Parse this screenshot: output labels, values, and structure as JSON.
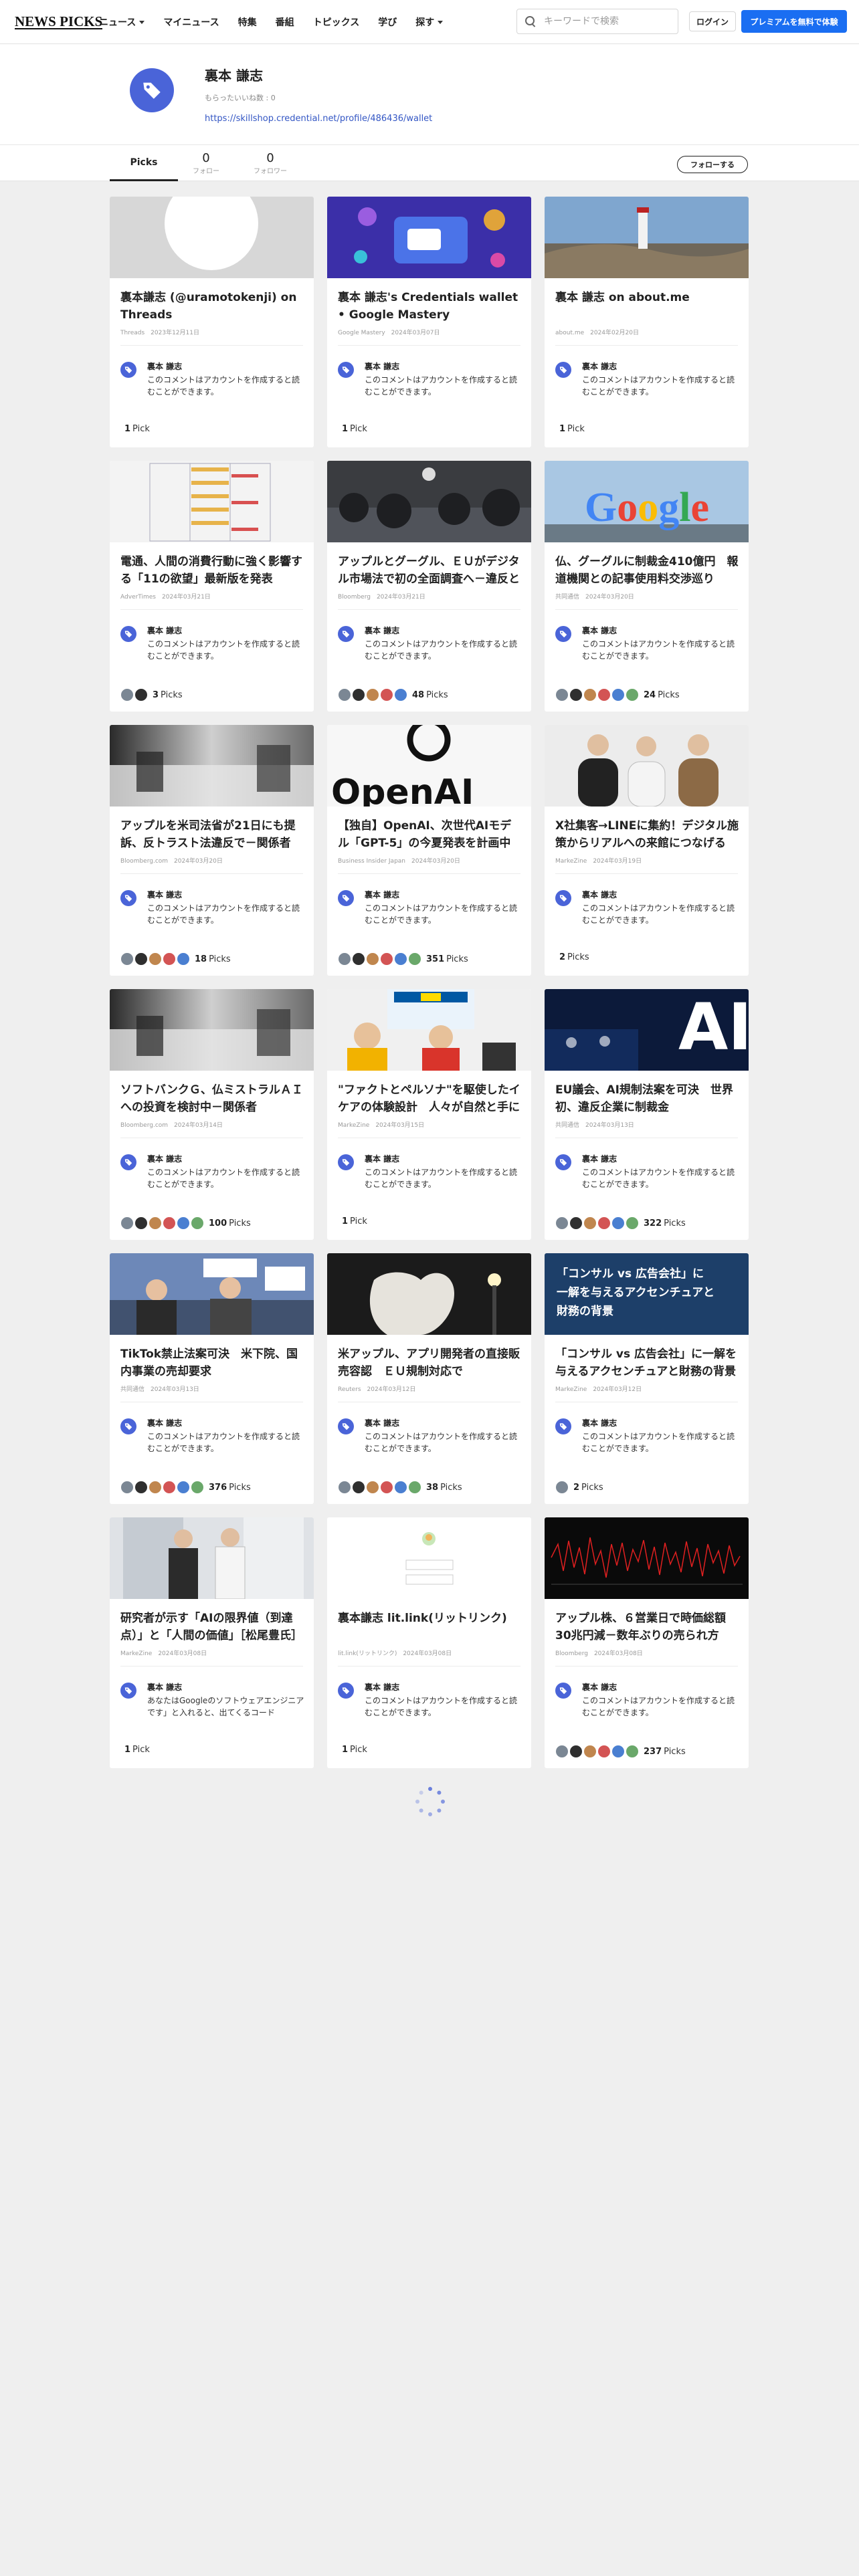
{
  "header": {
    "logo": "NEWS PICKS",
    "nav": [
      {
        "label": "ニュース",
        "dropdown": true
      },
      {
        "label": "マイニュース",
        "dropdown": false
      },
      {
        "label": "特集",
        "dropdown": false
      },
      {
        "label": "番組",
        "dropdown": false
      },
      {
        "label": "トピックス",
        "dropdown": false
      },
      {
        "label": "学び",
        "dropdown": false
      },
      {
        "label": "探す",
        "dropdown": true
      }
    ],
    "search_placeholder": "キーワードで検索",
    "login_label": "ログイン",
    "premium_label": "プレミアムを無料で体験"
  },
  "profile": {
    "name": "裏本 謙志",
    "liked": "もらったいいね数 : 0",
    "link": "https://skillshop.credential.net/profile/486436/wallet"
  },
  "tabs": {
    "picks_label": "Picks",
    "following_count": "0",
    "following_label": "フォロー",
    "followers_count": "0",
    "followers_label": "フォロワー",
    "follow_button": "フォローする"
  },
  "colors": {
    "accent": "#1a6ef2",
    "icon_blue": "#4a64d8",
    "link": "#3356c4"
  },
  "comment": {
    "author": "裏本 謙志",
    "text": "このコメントはアカウントを作成すると読むことができます。"
  },
  "cards": [
    {
      "title": "裏本謙志 (@uramotokenji) on Threads",
      "meta": "Threads　2023年12月11日",
      "picks": "1",
      "pick_label": "Pick",
      "avatars": 0,
      "thumb": "threads"
    },
    {
      "title": "裏本 謙志's Credentials wallet • Google Mastery",
      "meta": "Google Mastery　2024年03月07日",
      "picks": "1",
      "pick_label": "Pick",
      "avatars": 0,
      "thumb": "credentials"
    },
    {
      "title": "裏本 謙志 on about.me",
      "meta": "about.me　2024年02月20日",
      "picks": "1",
      "pick_label": "Pick",
      "avatars": 0,
      "thumb": "lighthouse"
    },
    {
      "title": "電通、人間の消費行動に強く影響する「11の欲望」最新版を発表",
      "meta": "AdverTimes　2024年03月21日",
      "picks": "3",
      "pick_label": "Picks",
      "avatars": 2,
      "thumb": "table"
    },
    {
      "title": "アップルとグーグル、ＥＵがデジタル市場法で初の全面調査へ－違反と判断なら制裁金も",
      "meta": "Bloomberg　2024年03月21日",
      "picks": "48",
      "pick_label": "Picks",
      "avatars": 5,
      "thumb": "applestore"
    },
    {
      "title": "仏、グーグルに制裁金410億円　報道機関との記事使用料交渉巡り",
      "meta": "共同通信　2024年03月20日",
      "picks": "24",
      "pick_label": "Picks",
      "avatars": 6,
      "thumb": "google"
    },
    {
      "title": "アップルを米司法省が21日にも提訴、反トラスト法違反で－関係者",
      "meta": "Bloomberg.com　2024年03月20日",
      "picks": "18",
      "pick_label": "Picks",
      "avatars": 5,
      "thumb": "chairs"
    },
    {
      "title": "【独自】OpenAI、次世代AIモデル「GPT-5」の今夏発表を計画中",
      "meta": "Business Insider Japan　2024年03月20日",
      "picks": "351",
      "pick_label": "Picks",
      "avatars": 6,
      "thumb": "openai"
    },
    {
      "title": "X社集客→LINEに集約！デジタル施策からリアルへの来館につなげる",
      "meta": "MarkeZine　2024年03月19日",
      "picks": "2",
      "pick_label": "Picks",
      "avatars": 0,
      "thumb": "people3"
    },
    {
      "title": "ソフトバンクＧ、仏ミストラルＡＩへの投資を検討中－関係者",
      "meta": "Bloomberg.com　2024年03月14日",
      "picks": "100",
      "pick_label": "Picks",
      "avatars": 6,
      "thumb": "chairs"
    },
    {
      "title": "\"ファクトとペルソナ\"を駆使したイケアの体験設計　人々が自然と手に取る仕組み",
      "meta": "MarkeZine　2024年03月15日",
      "picks": "1",
      "pick_label": "Pick",
      "avatars": 0,
      "thumb": "ikea"
    },
    {
      "title": "EU議会、AI規制法案を可決　世界初、違反企業に制裁金",
      "meta": "共同通信　2024年03月13日",
      "picks": "322",
      "pick_label": "Picks",
      "avatars": 6,
      "thumb": "ai"
    },
    {
      "title": "TikTok禁止法案可決　米下院、国内事業の売却要求",
      "meta": "共同通信　2024年03月13日",
      "picks": "376",
      "pick_label": "Picks",
      "avatars": 6,
      "thumb": "tiktok"
    },
    {
      "title": "米アップル、アプリ開発者の直接販売容認　ＥＵ規制対応で",
      "meta": "Reuters　2024年03月12日",
      "picks": "38",
      "pick_label": "Picks",
      "avatars": 6,
      "thumb": "applelogo"
    },
    {
      "title": "「コンサル vs 広告会社」に一解を与えるアクセンチュアと財務の背景",
      "meta": "MarkeZine　2024年03月12日",
      "picks": "2",
      "pick_label": "Picks",
      "avatars": 1,
      "thumb": "consul"
    },
    {
      "title": "研究者が示す「AIの限界値（到達点）」と「人間の価値」［松尾豊氏］",
      "meta": "MarkeZine　2024年03月08日",
      "picks": "1",
      "pick_label": "Pick",
      "avatars": 0,
      "thumb": "twomen",
      "comment_text": "あなたはGoogleのソフトウェアエンジニアです」と入れると、出てくるコード"
    },
    {
      "title": "裏本謙志 lit.link(リットリンク)",
      "meta": "lit.link(リットリンク)　2024年03月08日",
      "picks": "1",
      "pick_label": "Pick",
      "avatars": 0,
      "thumb": "litlink"
    },
    {
      "title": "アップル株、６営業日で時価総額30兆円減－数年ぶりの売られ方",
      "meta": "Bloomberg　2024年03月08日",
      "picks": "237",
      "pick_label": "Picks",
      "avatars": 6,
      "thumb": "chart"
    }
  ]
}
